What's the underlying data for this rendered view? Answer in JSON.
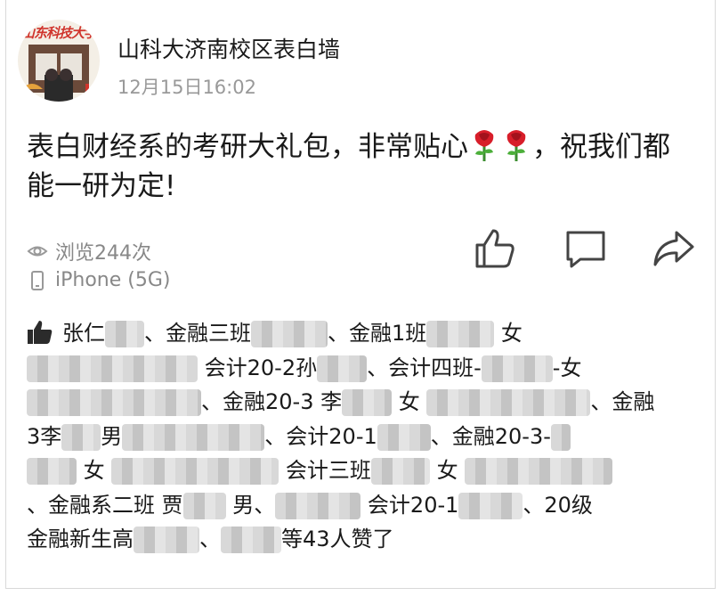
{
  "post": {
    "avatar_text": "山东科技大学",
    "author": "山科大济南校区表白墙",
    "time": "12月15日16:02",
    "content_prefix": "表白财经系的考研大礼包，非常贴心",
    "content_suffix": "，祝我们都能一研为定!",
    "views": "浏览244次",
    "device": "iPhone (5G)"
  },
  "likes": {
    "seg1": "张仁",
    "seg2": "、金融三班",
    "seg3": "、金融1班",
    "seg4": "女",
    "seg5": "会计20-2孙",
    "seg6": "、会计四班-",
    "seg7": "-女",
    "seg8": "、金融20-3 李",
    "seg9": "女",
    "seg10": "、金融",
    "seg11": "3李",
    "seg12": "男",
    "seg13": "、会计20-1",
    "seg14": "、金融20-3-",
    "seg15": "女",
    "seg16": "会计三班",
    "seg17": "女",
    "seg18": "、金融系二班 贾",
    "seg19": "男、",
    "seg20": "会计20-1",
    "seg21": "、20级",
    "seg22": "金融新生高",
    "seg23": "、",
    "seg24": "等43人赞了"
  }
}
